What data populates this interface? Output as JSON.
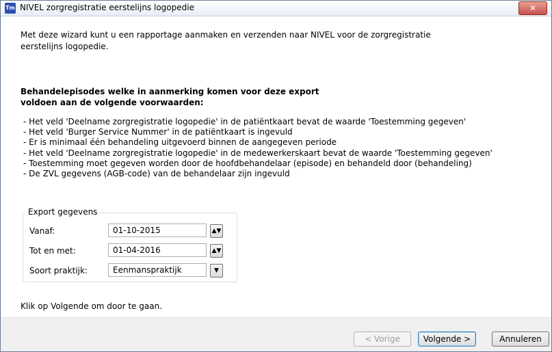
{
  "window": {
    "title": "NIVEL zorgregistratie eerstelijns logopedie",
    "icon_text": "Tm",
    "close": "✕"
  },
  "intro": "Met deze wizard kunt u een rapportage aanmaken en verzenden naar NIVEL voor de zorgregistratie\neerstelijns logopedie.",
  "heading": "Behandelepisodes welke in aanmerking komen voor deze export\nvoldoen aan de volgende voorwaarden:",
  "conditions": [
    "- Het veld 'Deelname zorgregistratie logopedie' in de patiëntkaart bevat de waarde 'Toestemming gegeven'",
    "- Het veld 'Burger Service Nummer' in de patiëntkaart is ingevuld",
    "- Er is minimaal één behandeling uitgevoerd binnen de aangegeven periode",
    "- Het veld 'Deelname zorgregistratie logopedie' in de medewerkerskaart bevat de waarde 'Toestemming gegeven'",
    "- Toestemming moet gegeven worden door de hoofdbehandelaar (episode) en behandeld door (behandeling)",
    "- De ZVL gegevens (AGB-code) van de behandelaar zijn ingevuld"
  ],
  "export": {
    "legend": "Export gegevens",
    "vanaf_label": "Vanaf:",
    "vanaf_value": "01-10-2015",
    "tot_label": "Tot en met:",
    "tot_value": "01-04-2016",
    "soort_label": "Soort praktijk:",
    "soort_value": "Eenmanspraktijk",
    "spin_glyph": "▲▼",
    "dropdown_glyph": "▼"
  },
  "hint": "Klik op Volgende om door te gaan.",
  "buttons": {
    "vorige": "< Vorige",
    "volgende": "Volgende >",
    "annuleren": "Annuleren"
  }
}
